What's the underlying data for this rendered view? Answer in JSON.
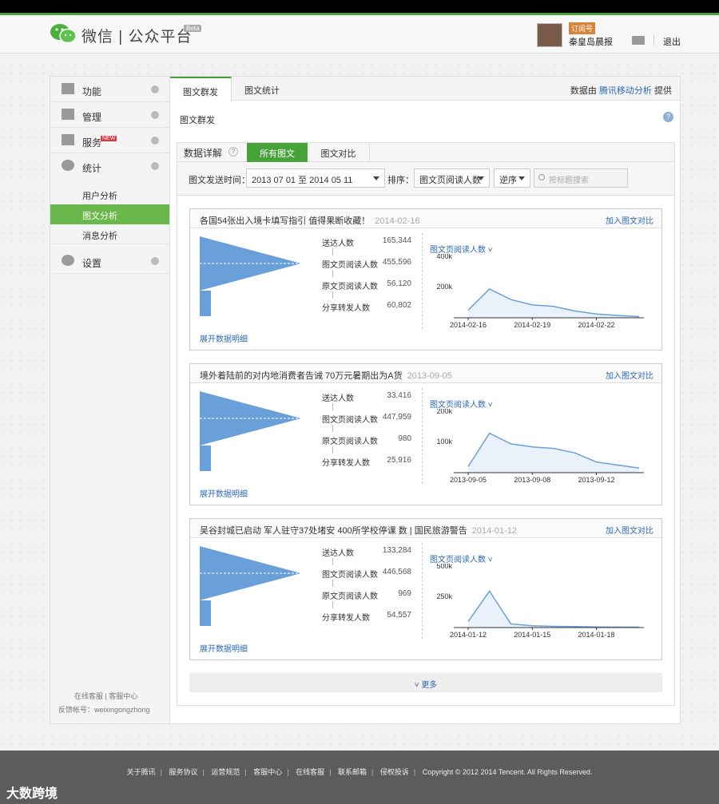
{
  "header": {
    "brand": "微信 | 公众平台",
    "beta": "Beta",
    "subscribe_badge": "订阅号",
    "account_name": "秦皇岛晨报",
    "logout": "退出"
  },
  "sidebar": {
    "items": [
      {
        "label": "功能",
        "icon": "grid-icon"
      },
      {
        "label": "管理",
        "icon": "inbox-icon"
      },
      {
        "label": "服务",
        "icon": "printer-icon",
        "badge": "NEW"
      },
      {
        "label": "统计",
        "icon": "pie-chart-icon"
      },
      {
        "label": "设置",
        "icon": "gear-icon"
      }
    ],
    "sub_items": [
      "用户分析",
      "图文分析",
      "消息分析"
    ],
    "footer_line1": "在线客服 | 客服中心",
    "footer_line2": "反馈帐号：weixingongzhong"
  },
  "main": {
    "tabs": [
      "图文群发",
      "图文统计"
    ],
    "provider_prefix": "数据由",
    "provider_link": "腾讯移动分析",
    "provider_suffix": "提供",
    "page_title": "图文群发",
    "help": "?"
  },
  "panel": {
    "lead": "数据详解",
    "q": "?",
    "tabs": [
      "所有图文",
      "图文对比"
    ],
    "filter_label": "图文发送时间：",
    "date_range": "2013 07 01 至 2014 05 11",
    "sort_label": "排序：",
    "sort_by": "图文页阅读人数",
    "order": "逆序",
    "search_placeholder": "按标题搜索",
    "more": "更多"
  },
  "cards": [
    {
      "title": "各国54张出入境卡填写指引 值得果断收藏！",
      "date": "2014-02-16",
      "add": "加入图文对比",
      "metrics": [
        {
          "label": "送达人数",
          "value": "165,344"
        },
        {
          "label": "图文页阅读人数",
          "value": "455,596"
        },
        {
          "label": "原文页阅读人数",
          "value": "56,120"
        },
        {
          "label": "分享转发人数",
          "value": "60,802"
        }
      ],
      "metric_dropdown": "图文页阅读人数",
      "expand": "展开数据明细"
    },
    {
      "title": "境外着陆前的对内地消费者告诫 70万元暑期出为A货",
      "date": "2013-09-05",
      "add": "加入图文对比",
      "metrics": [
        {
          "label": "送达人数",
          "value": "33,416"
        },
        {
          "label": "图文页阅读人数",
          "value": "447,959"
        },
        {
          "label": "原文页阅读人数",
          "value": "980"
        },
        {
          "label": "分享转发人数",
          "value": "25,916"
        }
      ],
      "metric_dropdown": "图文页阅读人数",
      "expand": "展开数据明细"
    },
    {
      "title": "吴谷封城已启动 军人驻守37处堵安 400所学校停课 数 | 国民旅游警告",
      "date": "2014-01-12",
      "add": "加入图文对比",
      "metrics": [
        {
          "label": "送达人数",
          "value": "133,284"
        },
        {
          "label": "图文页阅读人数",
          "value": "446,568"
        },
        {
          "label": "原文页阅读人数",
          "value": "969"
        },
        {
          "label": "分享转发人数",
          "value": "54,557"
        }
      ],
      "metric_dropdown": "图文页阅读人数",
      "expand": "展开数据明细"
    }
  ],
  "chart_data": [
    {
      "type": "area",
      "x": [
        "2014-02-16",
        "2014-02-17",
        "2014-02-18",
        "2014-02-19",
        "2014-02-20",
        "2014-02-21",
        "2014-02-22",
        "2014-02-23",
        "2014-02-24"
      ],
      "y": [
        50000,
        190000,
        120000,
        85000,
        75000,
        45000,
        25000,
        15000,
        8000
      ],
      "tick_labels_x": [
        "2014-02-16",
        "2014-02-19",
        "2014-02-22"
      ],
      "tick_labels_y": [
        "400k",
        "200k"
      ],
      "ylim": [
        0,
        400000
      ],
      "color": "#6aa0da"
    },
    {
      "type": "area",
      "x": [
        "2013-09-05",
        "2013-09-06",
        "2013-09-07",
        "2013-09-08",
        "2013-09-09",
        "2013-09-10",
        "2013-09-11",
        "2013-09-12",
        "2013-09-13"
      ],
      "y": [
        20000,
        130000,
        95000,
        85000,
        80000,
        65000,
        35000,
        25000,
        15000
      ],
      "tick_labels_x": [
        "2013-09-05",
        "2013-09-08",
        "2013-09-12"
      ],
      "tick_labels_y": [
        "200k",
        "100k"
      ],
      "ylim": [
        0,
        200000
      ],
      "color": "#6aa0da"
    },
    {
      "type": "area",
      "x": [
        "2014-01-12",
        "2014-01-13",
        "2014-01-14",
        "2014-01-15",
        "2014-01-16",
        "2014-01-17",
        "2014-01-18",
        "2014-01-19",
        "2014-01-20"
      ],
      "y": [
        50000,
        300000,
        30000,
        15000,
        10000,
        8000,
        5000,
        4000,
        3000
      ],
      "tick_labels_x": [
        "2014-01-12",
        "2014-01-15",
        "2014-01-18"
      ],
      "tick_labels_y": [
        "500k",
        "250k"
      ],
      "ylim": [
        0,
        500000
      ],
      "color": "#6aa0da"
    }
  ],
  "footer": {
    "links": [
      "关于腾讯",
      "服务协议",
      "运营规范",
      "客服中心",
      "在线客服",
      "联系邮箱",
      "侵权投诉"
    ],
    "copyright": "Copyright © 2012 2014 Tencent. All Rights Reserved.",
    "watermark": "大数跨境"
  },
  "colors": {
    "accent": "#47a23a",
    "link": "#2b68b3",
    "funnel": "#6aa0da"
  }
}
